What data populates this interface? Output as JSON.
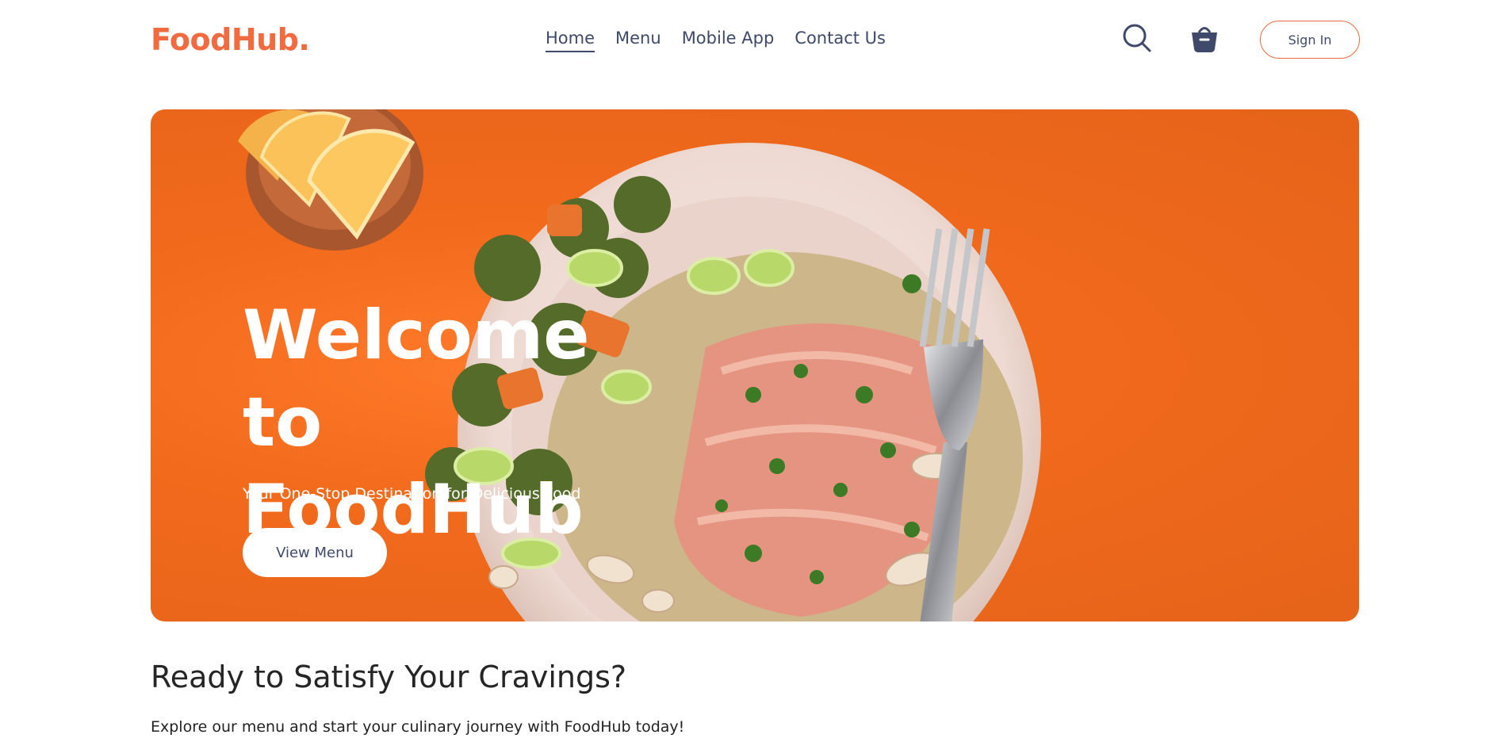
{
  "brand": {
    "logo": "FoodHub.",
    "accent": "#f26a3f",
    "nav_color": "#3f4a6b",
    "hero_color": "#f26a1c"
  },
  "nav": {
    "items": [
      {
        "label": "Home",
        "active": true
      },
      {
        "label": "Menu",
        "active": false
      },
      {
        "label": "Mobile App",
        "active": false
      },
      {
        "label": "Contact Us",
        "active": false
      }
    ],
    "search_icon": "search-icon",
    "cart_icon": "basket-icon",
    "signin_label": "Sign In"
  },
  "hero": {
    "title_line1": "Welcome to",
    "title_line2": "FoodHub",
    "subtitle": "Your One-Stop Destination for Delicious Food",
    "button_label": "View Menu",
    "image_subject": "plate of salmon with broccoli, quinoa and celery, lemon wedges in bowl, fork"
  },
  "cta": {
    "title": "Ready to Satisfy Your Cravings?",
    "text": "Explore our menu and start your culinary journey with FoodHub today!"
  }
}
